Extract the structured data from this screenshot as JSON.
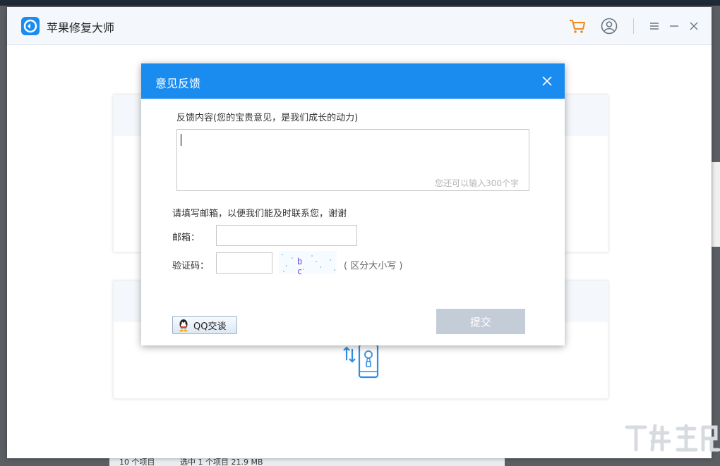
{
  "app": {
    "title": "苹果修复大师"
  },
  "feedback_dialog": {
    "title": "意见反馈",
    "content_label": "反馈内容(您的宝贵意见，是我们成长的动力)",
    "content_value": "",
    "remaining_hint": "您还可以输入300个字",
    "email_hint": "请填写邮箱，以便我们能及时联系您，谢谢",
    "email_label": "邮箱：",
    "email_value": "",
    "captcha_label": "验证码：",
    "captcha_value": "",
    "captcha_text": "b c",
    "captcha_note": "( 区分大小写 )",
    "qq_button_label": "QQ交谈",
    "submit_label": "提交"
  },
  "taskbar": {
    "items_count": "10 个项目",
    "selected_info": "选中 1 个项目  21.9 MB"
  },
  "colors": {
    "accent": "#1a8cf0",
    "submit_disabled": "#c4ccd8",
    "title_bar": "#f4f7fb"
  },
  "icons": [
    "app-logo-icon",
    "cart-icon",
    "user-icon",
    "menu-icon",
    "minimize-icon",
    "close-icon",
    "qq-penguin-icon",
    "phone-transfer-icon"
  ]
}
